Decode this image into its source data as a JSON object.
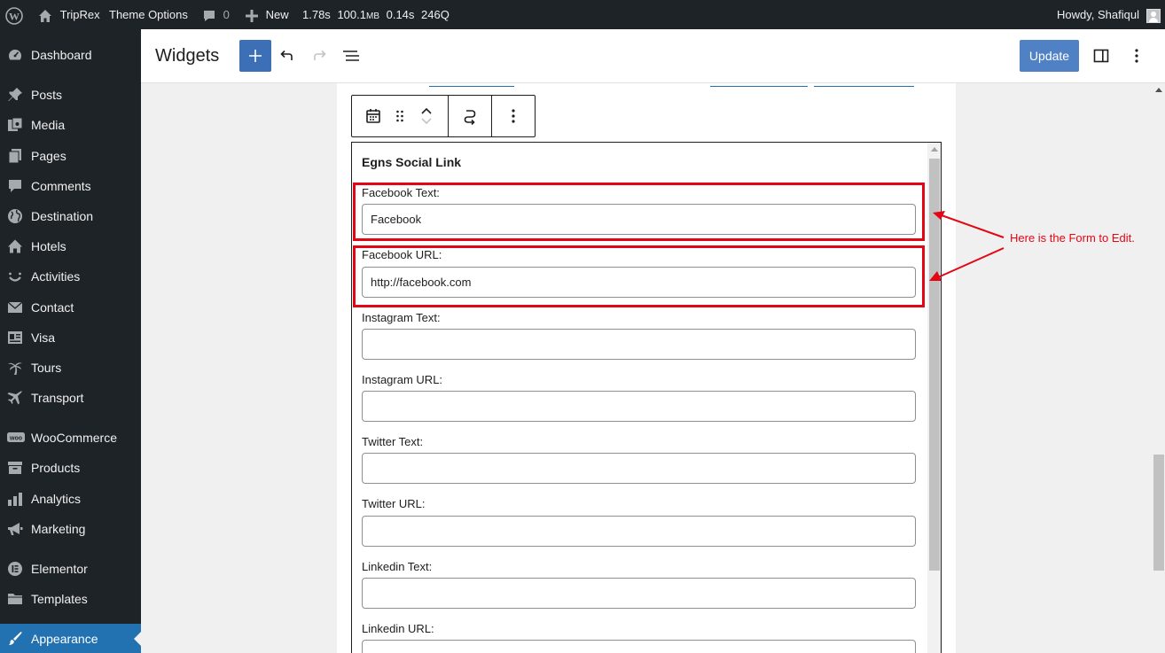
{
  "admin_bar": {
    "site_name": "TripRex",
    "theme_options": "Theme Options",
    "comments_count": "0",
    "new_label": "New",
    "stat_time": "1.78s",
    "stat_memory": "100.1",
    "stat_memory_unit": "MB",
    "stat_query_time": "0.14s",
    "stat_queries": "246Q",
    "greeting": "Howdy, Shafiqul"
  },
  "sidebar": {
    "items": [
      {
        "label": "Dashboard",
        "icon": "dashboard-icon"
      },
      {
        "label": "Posts",
        "icon": "pin-icon"
      },
      {
        "label": "Media",
        "icon": "media-icon"
      },
      {
        "label": "Pages",
        "icon": "pages-icon"
      },
      {
        "label": "Comments",
        "icon": "comment-icon"
      },
      {
        "label": "Destination",
        "icon": "globe-icon"
      },
      {
        "label": "Hotels",
        "icon": "home-icon"
      },
      {
        "label": "Activities",
        "icon": "smile-icon"
      },
      {
        "label": "Contact",
        "icon": "envelope-icon"
      },
      {
        "label": "Visa",
        "icon": "id-card-icon"
      },
      {
        "label": "Tours",
        "icon": "palm-tree-icon"
      },
      {
        "label": "Transport",
        "icon": "airplane-icon"
      },
      {
        "label": "WooCommerce",
        "icon": "woo-icon"
      },
      {
        "label": "Products",
        "icon": "archive-icon"
      },
      {
        "label": "Analytics",
        "icon": "bar-chart-icon"
      },
      {
        "label": "Marketing",
        "icon": "megaphone-icon"
      },
      {
        "label": "Elementor",
        "icon": "elementor-icon"
      },
      {
        "label": "Templates",
        "icon": "folder-icon"
      },
      {
        "label": "Appearance",
        "icon": "brush-icon",
        "current": true
      }
    ]
  },
  "editor_header": {
    "title": "Widgets",
    "update_label": "Update"
  },
  "widget_form": {
    "title": "Egns Social Link",
    "fields": [
      {
        "label": "Facebook Text:",
        "value": "Facebook"
      },
      {
        "label": "Facebook URL:",
        "value": "http://facebook.com"
      },
      {
        "label": "Instagram Text:",
        "value": ""
      },
      {
        "label": "Instagram URL:",
        "value": ""
      },
      {
        "label": "Twitter Text:",
        "value": ""
      },
      {
        "label": "Twitter URL:",
        "value": ""
      },
      {
        "label": "Linkedin Text:",
        "value": ""
      },
      {
        "label": "Linkedin URL:",
        "value": ""
      }
    ]
  },
  "annotation": {
    "text": "Here is the Form to Edit.",
    "color": "#e30613"
  },
  "colors": {
    "admin_dark": "#1d2327",
    "current_menu": "#2271b1",
    "update_button": "#4f81c4"
  }
}
